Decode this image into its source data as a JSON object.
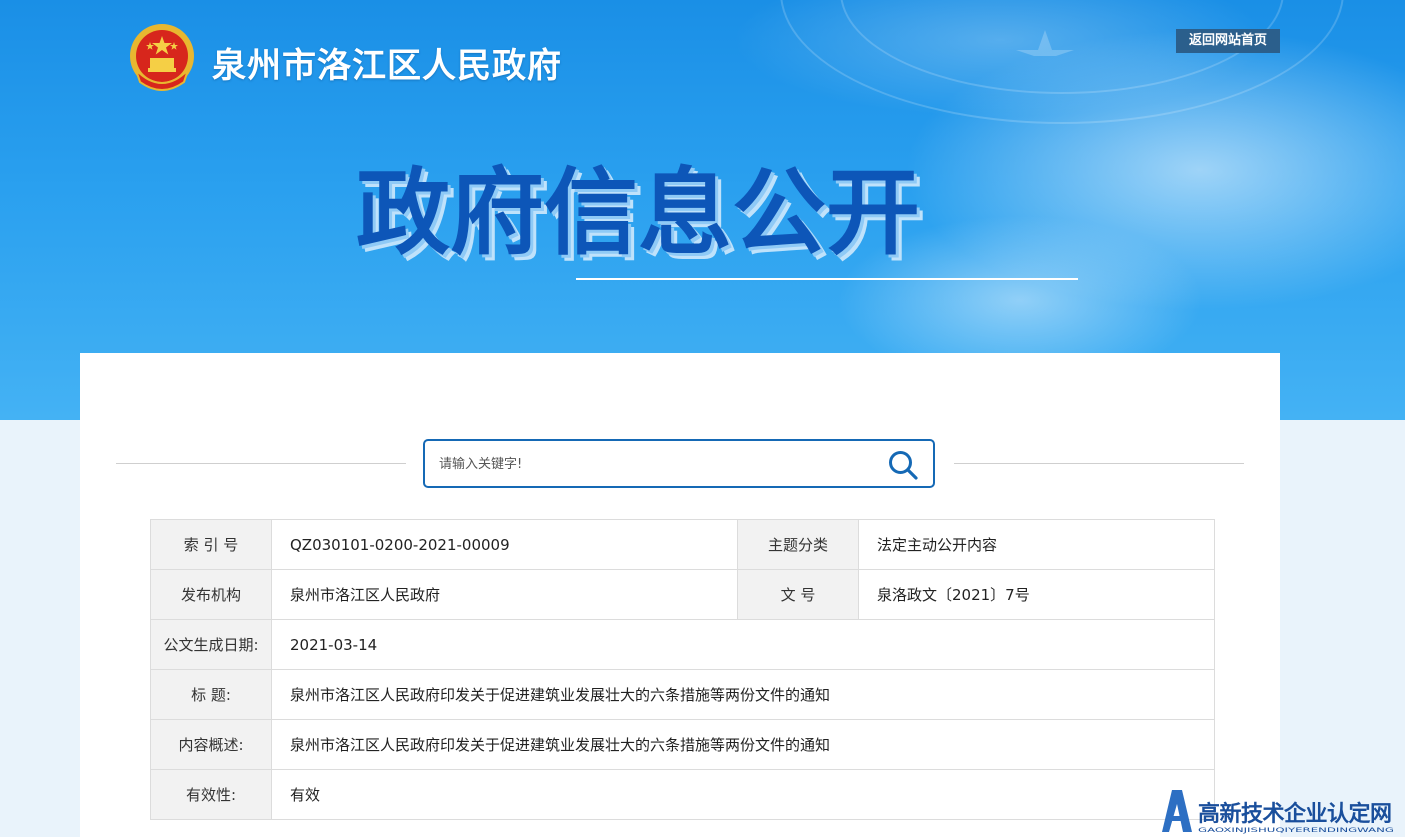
{
  "header": {
    "site_title": "泉州市洛江区人民政府",
    "home_button_label": "返回网站首页",
    "hero_title": "政府信息公开"
  },
  "search": {
    "placeholder": "请输入关键字!",
    "value": ""
  },
  "info_table": {
    "rows": [
      {
        "label_a": "索 引 号",
        "value_a": "QZ030101-0200-2021-00009",
        "label_b": "主题分类",
        "value_b": "法定主动公开内容"
      },
      {
        "label_a": "发布机构",
        "value_a": "泉州市洛江区人民政府",
        "label_b": "文 号",
        "value_b": "泉洛政文〔2021〕7号"
      },
      {
        "label": "公文生成日期:",
        "value": "2021-03-14"
      },
      {
        "label": "标 题:",
        "value": "泉州市洛江区人民政府印发关于促进建筑业发展壮大的六条措施等两份文件的通知"
      },
      {
        "label": "内容概述:",
        "value": "泉州市洛江区人民政府印发关于促进建筑业发展壮大的六条措施等两份文件的通知"
      },
      {
        "label": "有效性:",
        "value": "有效"
      }
    ]
  },
  "watermark": {
    "text": "高新技术企业认定网",
    "subtext": "GAOXINJISHUQIYERENDINGWANG"
  },
  "colors": {
    "banner_blue": "#1a8fe6",
    "hero_text": "#0d56b8",
    "search_border": "#1569b5",
    "home_button_bg": "#2b5f8c",
    "label_bg": "#f2f2f2"
  }
}
